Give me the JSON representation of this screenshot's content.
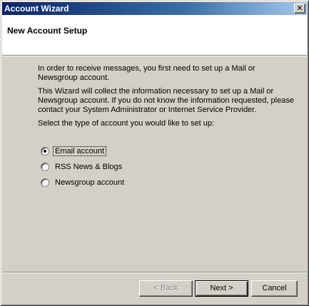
{
  "window": {
    "title": "Account Wizard",
    "close_glyph": "✕"
  },
  "header": {
    "title": "New Account Setup"
  },
  "content": {
    "paragraph1": "In order to receive messages, you first need to set up a Mail or Newsgroup account.",
    "paragraph2": "This Wizard will collect the information necessary to set up a Mail or Newsgroup account. If you do not know the information requested, please contact your System Administrator or Internet Service Provider.",
    "prompt": "Select the type of account you would like to set up:"
  },
  "account_types": [
    {
      "label": "Email account",
      "checked": true
    },
    {
      "label": "RSS News & Blogs",
      "checked": false
    },
    {
      "label": "Newsgroup account",
      "checked": false
    }
  ],
  "buttons": {
    "back": "< Back",
    "next": "Next >",
    "cancel": "Cancel"
  }
}
